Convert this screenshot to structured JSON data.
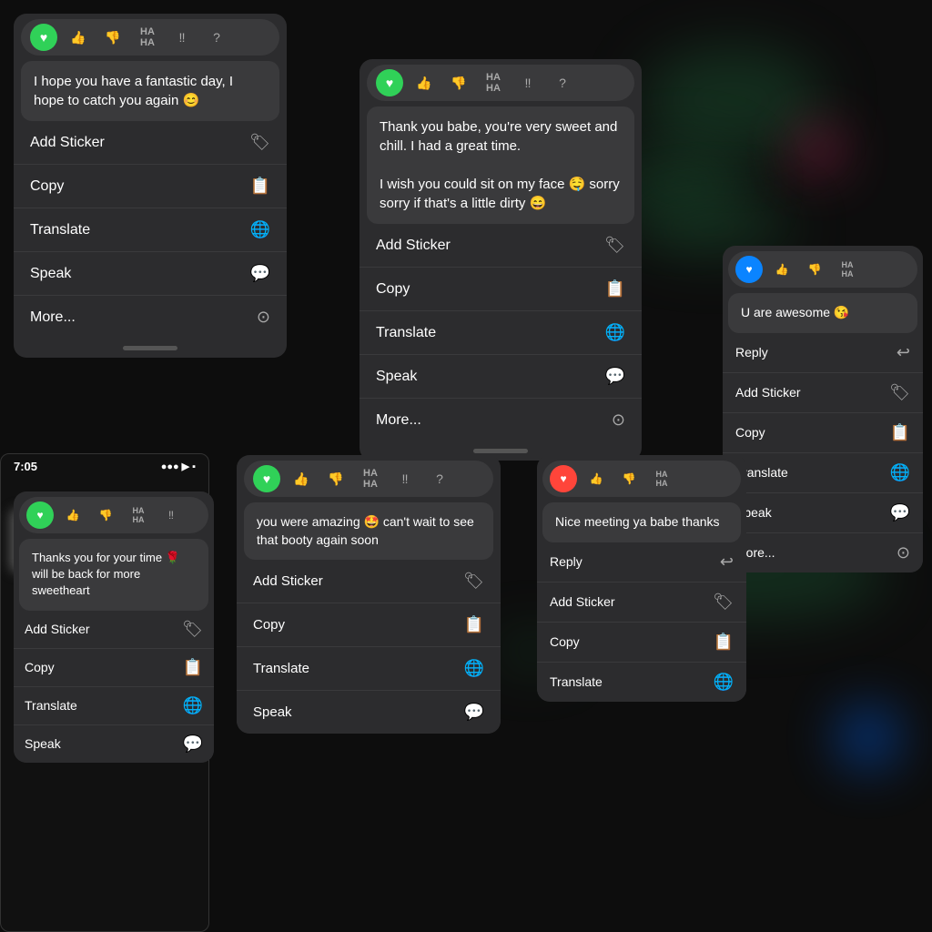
{
  "background": {
    "color": "#0d0d0d"
  },
  "panels": {
    "panel1": {
      "message": "I hope you have a fantastic day, I hope to catch you again 😊",
      "reaction_active": "heart-green",
      "menu_items": [
        {
          "label": "Add Sticker",
          "icon": "🏷"
        },
        {
          "label": "Copy",
          "icon": "📋"
        },
        {
          "label": "Translate",
          "icon": "🌐"
        },
        {
          "label": "Speak",
          "icon": "💬"
        },
        {
          "label": "More...",
          "icon": "⊙"
        }
      ]
    },
    "panel2": {
      "message": "Thank you babe, you're very sweet and chill. I had a great time.\n\nI wish you could sit on my face 🤤 sorry sorry if that's a little dirty 😄",
      "reaction_active": "heart-green",
      "menu_items": [
        {
          "label": "Add Sticker",
          "icon": "🏷"
        },
        {
          "label": "Copy",
          "icon": "📋"
        },
        {
          "label": "Translate",
          "icon": "🌐"
        },
        {
          "label": "Speak",
          "icon": "💬"
        },
        {
          "label": "More...",
          "icon": "⊙"
        }
      ]
    },
    "panel3": {
      "message": "U are awesome 😘",
      "reaction_active": "heart-blue",
      "menu_items": [
        {
          "label": "Reply",
          "icon": "↩"
        },
        {
          "label": "Add Sticker",
          "icon": "🏷"
        },
        {
          "label": "Copy",
          "icon": "📋"
        },
        {
          "label": "Translate",
          "icon": "🌐"
        },
        {
          "label": "Speak",
          "icon": "💬"
        },
        {
          "label": "More...",
          "icon": "⊙"
        }
      ]
    },
    "panel4": {
      "message": "you were amazing 🤩 can't wait to see that booty again soon",
      "reaction_active": "heart-green",
      "menu_items": [
        {
          "label": "Add Sticker",
          "icon": "🏷"
        },
        {
          "label": "Copy",
          "icon": "📋"
        },
        {
          "label": "Translate",
          "icon": "🌐"
        },
        {
          "label": "Speak",
          "icon": "💬"
        }
      ]
    },
    "panel5": {
      "message": "Nice meeting ya babe thanks",
      "reaction_active": "heart-red",
      "menu_items": [
        {
          "label": "Reply",
          "icon": "↩"
        },
        {
          "label": "Add Sticker",
          "icon": "🏷"
        },
        {
          "label": "Copy",
          "icon": "📋"
        },
        {
          "label": "Translate",
          "icon": "🌐"
        }
      ]
    },
    "panel6": {
      "message": "Thanks you for your time 🌹 will be back for more sweetheart",
      "reaction_active": "heart-green",
      "menu_items": [
        {
          "label": "Add Sticker",
          "icon": "🏷"
        },
        {
          "label": "Copy",
          "icon": "📋"
        },
        {
          "label": "Translate",
          "icon": "🌐"
        },
        {
          "label": "Speak",
          "icon": "💬"
        }
      ]
    }
  },
  "phone": {
    "time": "7:05",
    "signal": "●●● ▶ ▪"
  },
  "reactions": {
    "thumbs_up": "👍",
    "thumbs_down": "👎",
    "haha": "HA HA",
    "exclaim": "‼",
    "question": "?"
  }
}
